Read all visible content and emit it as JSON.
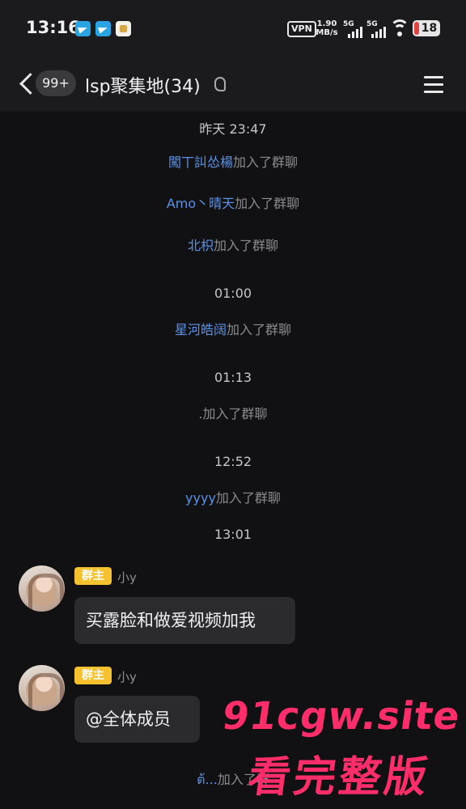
{
  "status_bar": {
    "time": "13:16",
    "vpn": "VPN",
    "net_speed_value": "1.90",
    "net_speed_unit": "MB/s",
    "signal_1": "5G",
    "signal_2": "5G",
    "battery": "18"
  },
  "nav": {
    "unread_badge": "99+",
    "title": "lsp聚集地(34)"
  },
  "messages": {
    "t1": "昨天 23:47",
    "j1_name": "闖丅訆怂楊",
    "j1_text": "加入了群聊",
    "j2_name": "Amo丶晴天",
    "j2_text": "加入了群聊",
    "j3_name": "北枳",
    "j3_text": "加入了群聊",
    "t2": "01:00",
    "j4_name": "星河皓阔",
    "j4_text": "加入了群聊",
    "t3": "01:13",
    "j5_text": ".加入了群聊",
    "t4": "12:52",
    "j6_name": "yyyy",
    "j6_text": "加入了群聊",
    "t5": "13:01",
    "m1_role": "群主",
    "m1_sender": "小y",
    "m1_text": "买露脸和做爱视频加我",
    "m2_role": "群主",
    "m2_sender": "小y",
    "m2_text": "@全体成员",
    "j7_name": "ต้...",
    "j7_text": "加入了群"
  },
  "watermark": {
    "line1": "91cgw.site",
    "line2": "看完整版"
  },
  "colors": {
    "background": "#111113",
    "bar": "#1b1b1d",
    "link_blue": "#5b92e8",
    "owner_badge": "#f5c12f",
    "watermark": "#ff2d6a"
  }
}
